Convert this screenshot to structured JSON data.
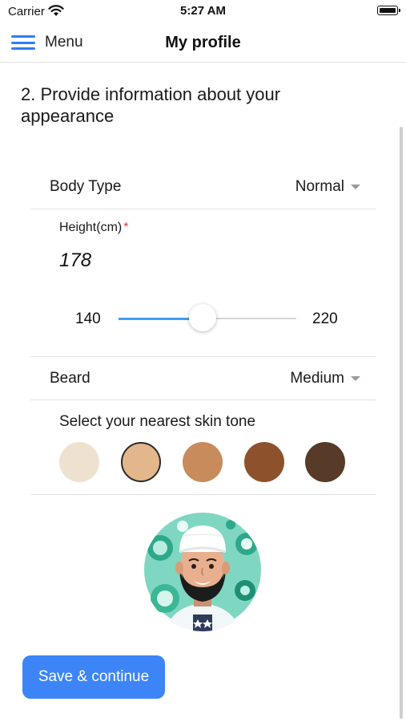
{
  "status_bar": {
    "carrier": "Carrier",
    "time": "5:27 AM"
  },
  "nav": {
    "menu_label": "Menu",
    "title": "My profile"
  },
  "section_title": "2. Provide information about your appearance",
  "body_type": {
    "label": "Body Type",
    "value": "Normal"
  },
  "height": {
    "label": "Height(cm)",
    "required_mark": "*",
    "value": "178",
    "min_label": "140",
    "max_label": "220",
    "min": 140,
    "max": 220,
    "current": 178
  },
  "beard": {
    "label": "Beard",
    "value": "Medium"
  },
  "skin_tone": {
    "label": "Select your nearest skin tone",
    "selected_index": 1,
    "options": [
      "#efe1cf",
      "#e3b68b",
      "#c88b5c",
      "#8d522b",
      "#573a27"
    ]
  },
  "save_button": {
    "label": "Save & continue"
  },
  "colors": {
    "accent": "#3d85f7",
    "slider_fill": "#3f9ef5",
    "required": "#e23b3b"
  }
}
